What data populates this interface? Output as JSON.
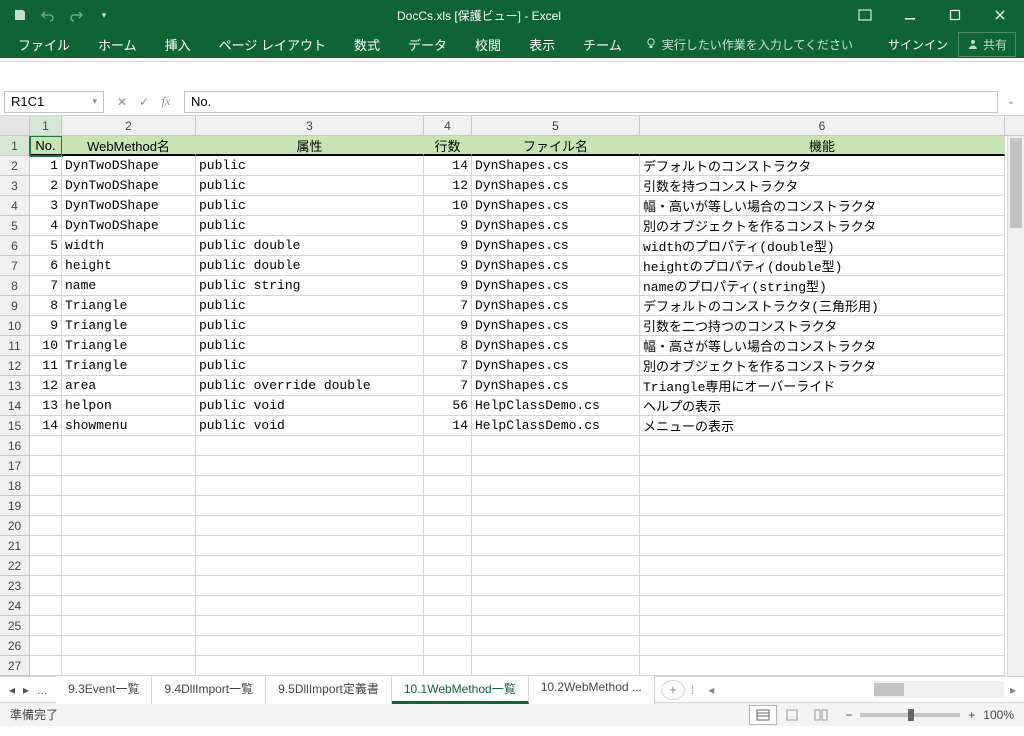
{
  "title": "DocCs.xls  [保護ビュー] - Excel",
  "qat": {
    "save": "save-icon",
    "undo": "undo-icon",
    "redo": "redo-icon"
  },
  "ribbon": {
    "tabs": [
      "ファイル",
      "ホーム",
      "挿入",
      "ページ レイアウト",
      "数式",
      "データ",
      "校閲",
      "表示",
      "チーム"
    ],
    "tellme": "実行したい作業を入力してください",
    "signin": "サインイン",
    "share": "共有"
  },
  "namebox": "R1C1",
  "formula": "No.",
  "columns": [
    {
      "n": "1",
      "w": "c1",
      "sel": true
    },
    {
      "n": "2",
      "w": "c2"
    },
    {
      "n": "3",
      "w": "c3"
    },
    {
      "n": "4",
      "w": "c4"
    },
    {
      "n": "5",
      "w": "c5"
    },
    {
      "n": "6",
      "w": "c6"
    }
  ],
  "headers": [
    "No.",
    "WebMethod名",
    "属性",
    "行数",
    "ファイル名",
    "機能"
  ],
  "rows": [
    {
      "no": 1,
      "name": "DynTwoDShape",
      "attr": "public",
      "lines": 14,
      "file": "DynShapes.cs",
      "func": "デフォルトのコンストラクタ"
    },
    {
      "no": 2,
      "name": "DynTwoDShape",
      "attr": "public",
      "lines": 12,
      "file": "DynShapes.cs",
      "func": "引数を持つコンストラクタ"
    },
    {
      "no": 3,
      "name": "DynTwoDShape",
      "attr": "public",
      "lines": 10,
      "file": "DynShapes.cs",
      "func": "幅・高いが等しい場合のコンストラクタ"
    },
    {
      "no": 4,
      "name": "DynTwoDShape",
      "attr": "public",
      "lines": 9,
      "file": "DynShapes.cs",
      "func": "別のオブジェクトを作るコンストラクタ"
    },
    {
      "no": 5,
      "name": "width",
      "attr": "public double",
      "lines": 9,
      "file": "DynShapes.cs",
      "func": "widthのプロパティ(double型)"
    },
    {
      "no": 6,
      "name": "height",
      "attr": "public double",
      "lines": 9,
      "file": "DynShapes.cs",
      "func": "heightのプロパティ(double型)"
    },
    {
      "no": 7,
      "name": "name",
      "attr": "public string",
      "lines": 9,
      "file": "DynShapes.cs",
      "func": "nameのプロパティ(string型)"
    },
    {
      "no": 8,
      "name": "Triangle",
      "attr": "public",
      "lines": 7,
      "file": "DynShapes.cs",
      "func": "デフォルトのコンストラクタ(三角形用)"
    },
    {
      "no": 9,
      "name": "Triangle",
      "attr": "public",
      "lines": 9,
      "file": "DynShapes.cs",
      "func": "引数を二つ持つのコンストラクタ"
    },
    {
      "no": 10,
      "name": "Triangle",
      "attr": "public",
      "lines": 8,
      "file": "DynShapes.cs",
      "func": "幅・高さが等しい場合のコンストラクタ"
    },
    {
      "no": 11,
      "name": "Triangle",
      "attr": "public",
      "lines": 7,
      "file": "DynShapes.cs",
      "func": "別のオブジェクトを作るコンストラクタ"
    },
    {
      "no": 12,
      "name": "area",
      "attr": "public override double",
      "lines": 7,
      "file": "DynShapes.cs",
      "func": "Triangle専用にオーバーライド"
    },
    {
      "no": 13,
      "name": "helpon",
      "attr": "public void",
      "lines": 56,
      "file": "HelpClassDemo.cs",
      "func": "ヘルプの表示"
    },
    {
      "no": 14,
      "name": "showmenu",
      "attr": "public void",
      "lines": 14,
      "file": "HelpClassDemo.cs",
      "func": "メニューの表示"
    }
  ],
  "empty_rows": 12,
  "sheets": {
    "ellipsis": "...",
    "tabs": [
      {
        "label": "9.3Event一覧",
        "active": false
      },
      {
        "label": "9.4DllImport一覧",
        "active": false
      },
      {
        "label": "9.5DllImport定義書",
        "active": false
      },
      {
        "label": "10.1WebMethod一覧",
        "active": true
      },
      {
        "label": "10.2WebMethod ...",
        "active": false
      }
    ]
  },
  "status": {
    "ready": "準備完了",
    "zoom": "100%"
  }
}
